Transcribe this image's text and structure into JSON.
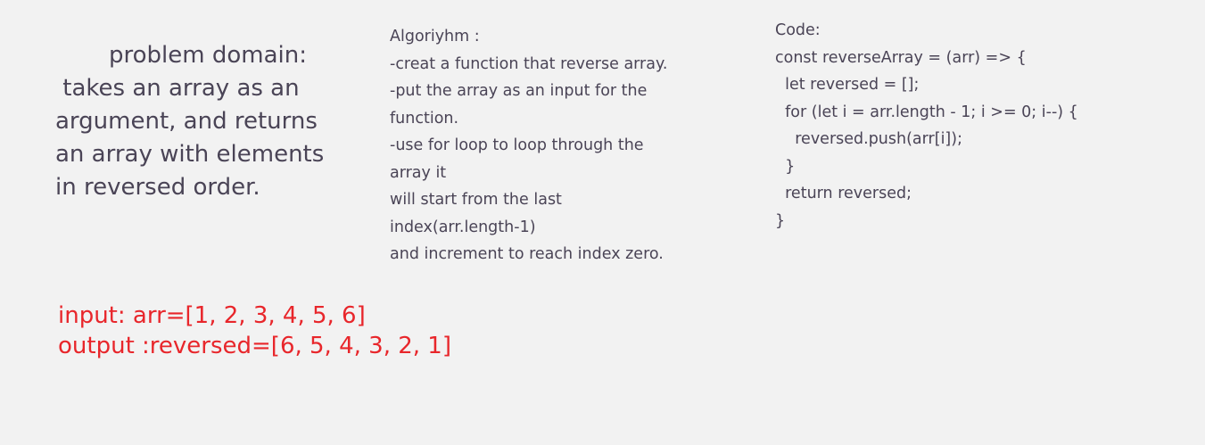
{
  "problem_domain": {
    "title": "problem domain:",
    "lines": [
      " takes an array as an",
      "argument, and returns",
      "an array with elements",
      "in reversed order."
    ]
  },
  "algorithm": {
    "lines": [
      "Algoriyhm :",
      "-creat a function that reverse array.",
      "-put the array as an input for the",
      "function.",
      "-use for loop to loop through the",
      "array it",
      "will start from the last",
      "index(arr.length-1)",
      "and increment to reach index zero."
    ]
  },
  "code": {
    "lines": [
      "Code:",
      "const reverseArray = (arr) => {",
      "  let reversed = [];",
      "  for (let i = arr.length - 1; i >= 0; i--) {",
      "    reversed.push(arr[i]);",
      "  }",
      "  return reversed;",
      "}"
    ]
  },
  "io": {
    "input": "input: arr=[1, 2, 3, 4, 5, 6]",
    "output": "output :reversed=[6, 5, 4, 3, 2, 1]"
  },
  "colors": {
    "background": "#f2f2f2",
    "text": "#4a4456",
    "io_text": "#e8262b"
  }
}
